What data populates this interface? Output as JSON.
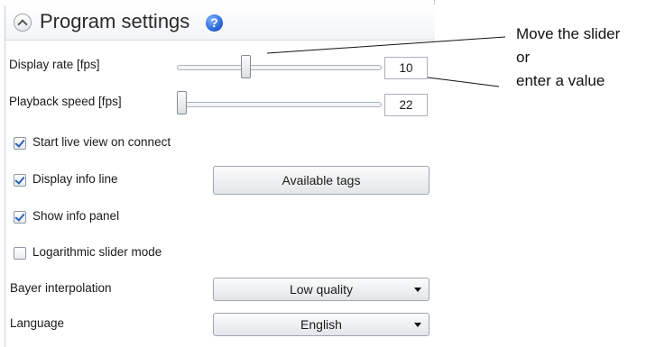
{
  "panel": {
    "title": "Program settings",
    "help_icon": "?",
    "display_rate": {
      "label": "Display rate [fps]",
      "value": "10",
      "slider_level": 0.33
    },
    "playback_speed": {
      "label": "Playback speed [fps]",
      "value": "22",
      "slider_level": 0.0
    },
    "checkboxes": [
      {
        "label": "Start live view on connect",
        "checked": true
      },
      {
        "label": "Display info line",
        "checked": true
      },
      {
        "label": "Show info panel",
        "checked": true
      },
      {
        "label": "Logarithmic slider mode",
        "checked": false
      }
    ],
    "available_tags_button": "Available tags",
    "bayer": {
      "label": "Bayer interpolation",
      "selected": "Low quality"
    },
    "language": {
      "label": "Language",
      "selected": "English"
    }
  },
  "annotation": {
    "line1": "Move the slider",
    "line2": "or",
    "line3": "enter a value"
  },
  "colors": {
    "help_icon": "#1f5fd1",
    "check_mark": "#2a5fb7"
  }
}
